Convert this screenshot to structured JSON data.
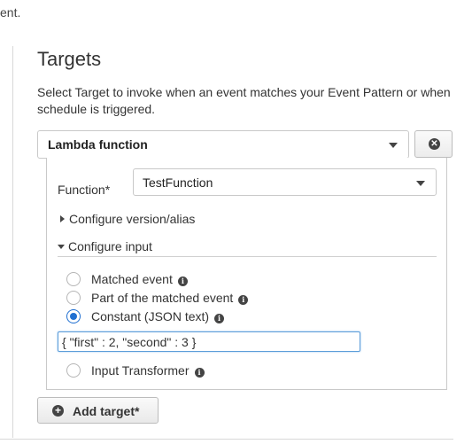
{
  "page": {
    "top_fragment": "ent."
  },
  "targets": {
    "title": "Targets",
    "description": "Select Target to invoke when an event matches your Event Pattern or when schedule is triggered.",
    "target_type": "Lambda function",
    "function_label": "Function*",
    "function_value": "TestFunction",
    "configure_version_label": "Configure version/alias",
    "configure_input_label": "Configure input",
    "input_options": [
      {
        "label": "Matched event",
        "checked": false,
        "info": true
      },
      {
        "label": "Part of the matched event",
        "checked": false,
        "info": true
      },
      {
        "label": "Constant (JSON text)",
        "checked": true,
        "info": true
      },
      {
        "label": "Input Transformer",
        "checked": false,
        "info": true
      }
    ],
    "constant_json_value": "{ \"first\" : 2, \"second\" : 3 }",
    "add_target_label": "Add target*"
  },
  "icons": {
    "remove": "remove-circle-icon",
    "add": "plus-circle-icon",
    "info": "info-icon",
    "dropdown": "chevron-down-icon"
  },
  "colors": {
    "accent": "#1f6fd1",
    "focus_border": "#5b9dd9"
  }
}
